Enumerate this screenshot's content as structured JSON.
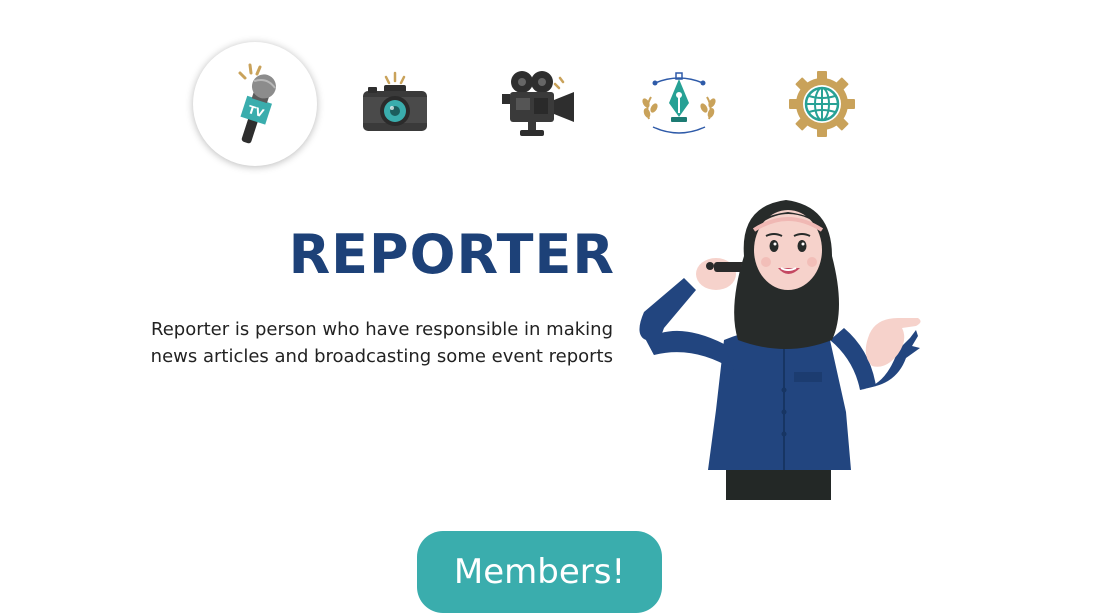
{
  "nav": {
    "icons": [
      {
        "name": "microphone-tv-icon",
        "label": "TV",
        "active": true
      },
      {
        "name": "camera-icon",
        "active": false
      },
      {
        "name": "video-camera-icon",
        "active": false
      },
      {
        "name": "pen-tool-icon",
        "active": false
      },
      {
        "name": "globe-gear-icon",
        "active": false
      }
    ]
  },
  "main": {
    "title": "REPORTER",
    "description": "Reporter is person who have responsible in making news articles and broadcasting some event reports"
  },
  "cta": {
    "label": "Members!"
  },
  "colors": {
    "title": "#1d4178",
    "accent": "#3aadad",
    "gold": "#c9a25a",
    "jacket": "#22457f",
    "hijab": "#272b2a"
  }
}
